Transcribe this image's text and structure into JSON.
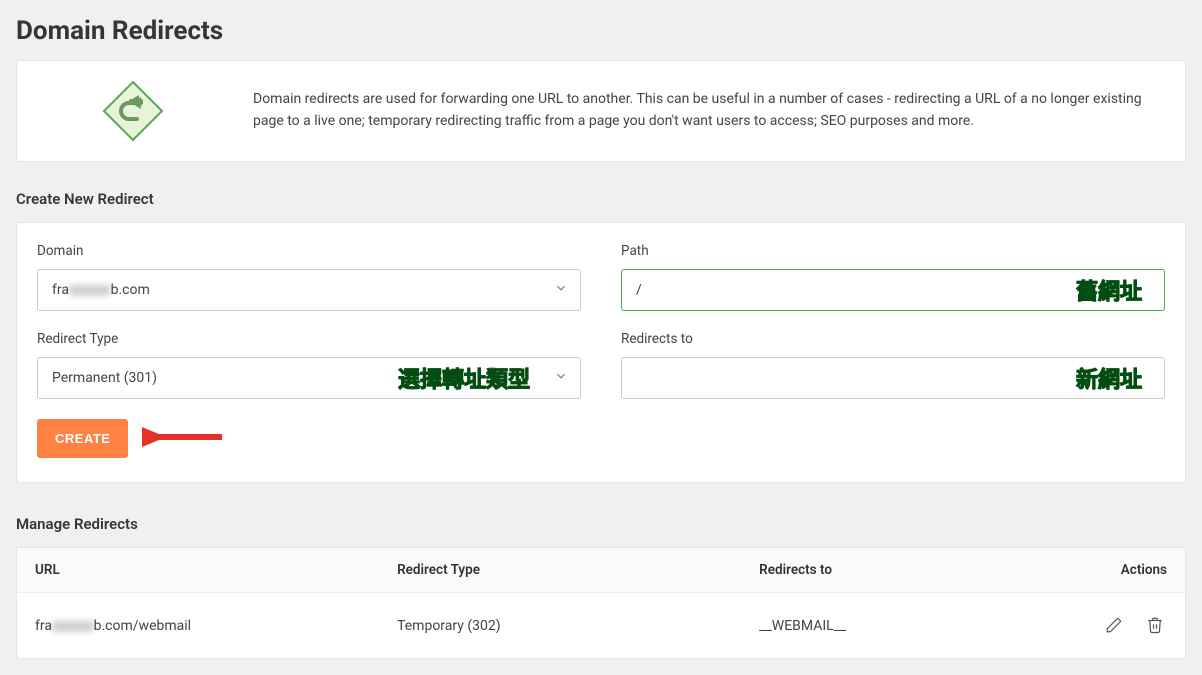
{
  "page": {
    "title": "Domain Redirects"
  },
  "intro": {
    "text": "Domain redirects are used for forwarding one URL to another. This can be useful in a number of cases - redirecting a URL of a no longer existing page to a live one; temporary redirecting traffic from a page you don't want users to access; SEO purposes and more."
  },
  "form": {
    "section_title": "Create New Redirect",
    "domain_label": "Domain",
    "domain_value_prefix": "fra",
    "domain_value_blur": "xxxxxx",
    "domain_value_suffix": "b.com",
    "path_label": "Path",
    "path_value": "/",
    "path_annotation": "舊網址",
    "redirect_type_label": "Redirect Type",
    "redirect_type_value": "Permanent (301)",
    "redirect_type_annotation": "選擇轉址類型",
    "redirects_to_label": "Redirects to",
    "redirects_to_value": "",
    "redirects_to_annotation": "新網址",
    "create_button": "CREATE"
  },
  "manage": {
    "section_title": "Manage Redirects",
    "columns": {
      "url": "URL",
      "type": "Redirect Type",
      "to": "Redirects to",
      "actions": "Actions"
    },
    "rows": [
      {
        "url_prefix": "fra",
        "url_blur": "xxxxxx",
        "url_suffix": "b.com/webmail",
        "type": "Temporary (302)",
        "to": "__WEBMAIL__"
      }
    ]
  }
}
